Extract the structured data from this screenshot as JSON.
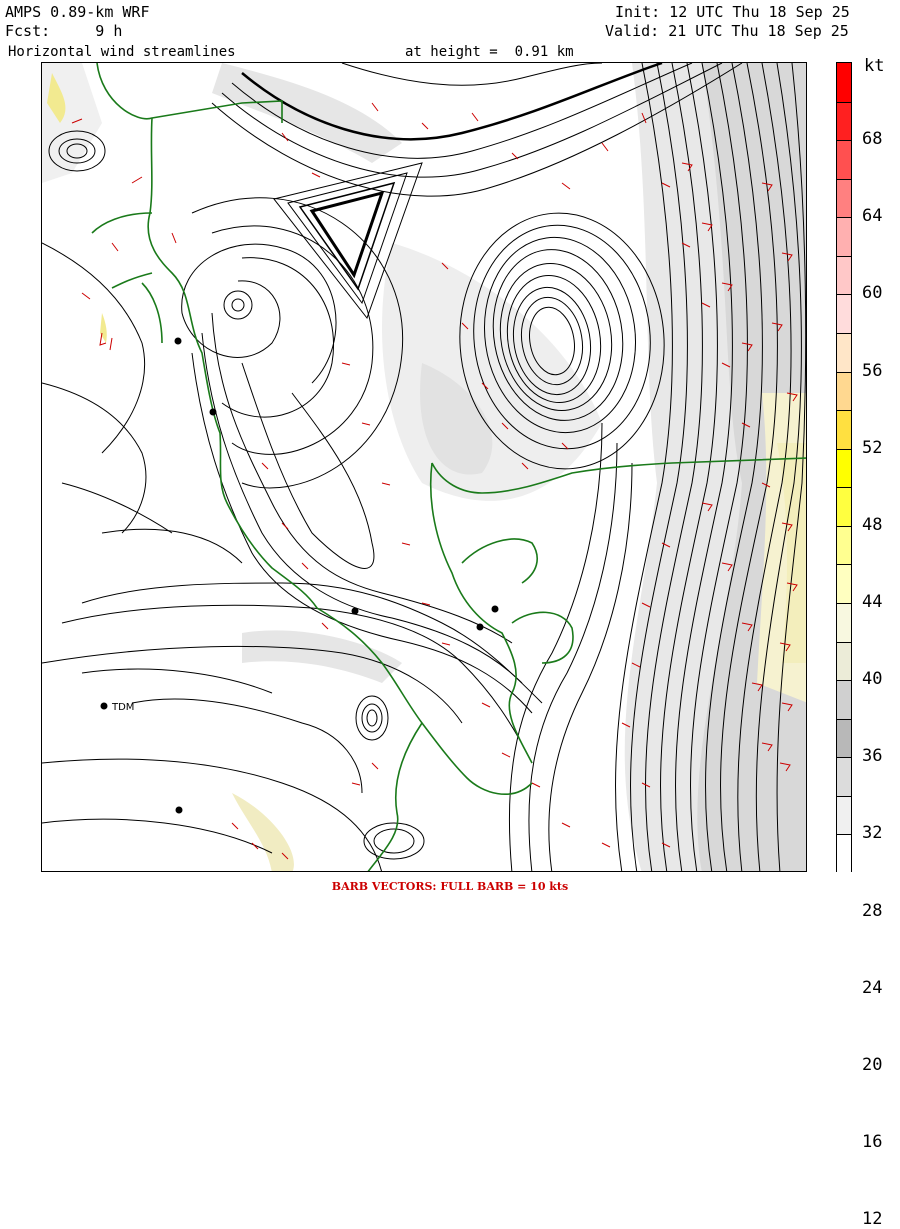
{
  "header": {
    "model": "AMPS 0.89-km WRF",
    "fcst": "Fcst:     9 h",
    "field": "Horizontal wind streamlines",
    "height": "at height =  0.91 km",
    "init": "Init: 12 UTC Thu 18 Sep 25",
    "valid": "Valid: 21 UTC Thu 18 Sep 25"
  },
  "colorbar": {
    "unit": "kt",
    "labels": [
      "68",
      "64",
      "60",
      "56",
      "52",
      "48",
      "44",
      "40",
      "36",
      "32",
      "28",
      "24",
      "20",
      "16",
      "12"
    ],
    "colors": [
      "#ff0000",
      "#ff2020",
      "#ff5050",
      "#ff8080",
      "#ffb0b0",
      "#ffc8c8",
      "#ffdcdc",
      "#ffe6c8",
      "#ffd890",
      "#ffe040",
      "#ffff00",
      "#ffff40",
      "#ffff90",
      "#ffffc0",
      "#f8f8e0",
      "#ececd8",
      "#d0d0d0",
      "#b8b8b8",
      "#dcdcdc",
      "#f0f0f0",
      "#ffffff"
    ]
  },
  "stations": [
    {
      "name": "TDM"
    }
  ],
  "footer": "BARB VECTORS:  FULL BARB = 10 kts"
}
